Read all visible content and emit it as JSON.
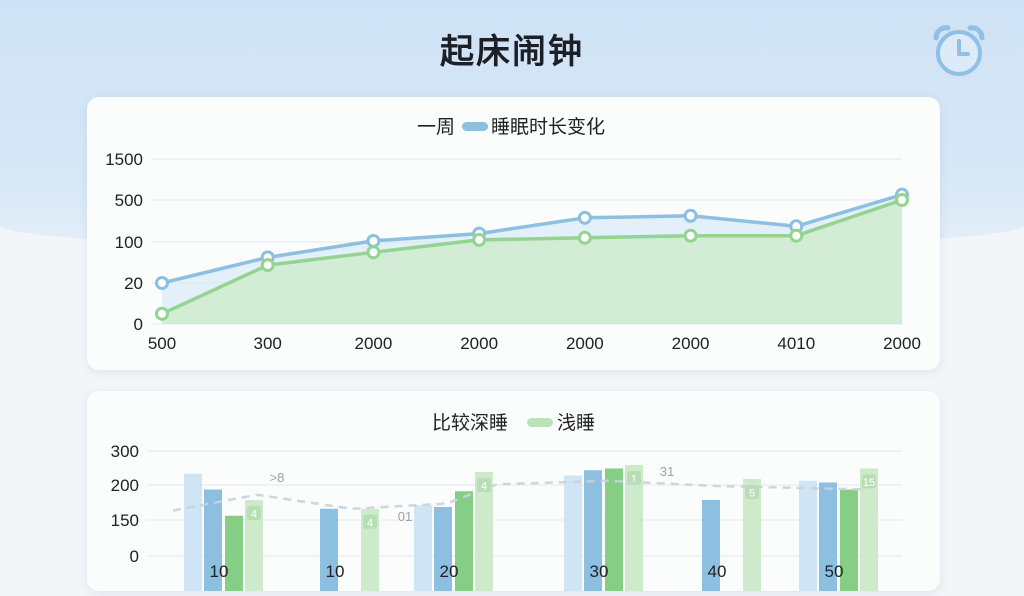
{
  "app": {
    "title": "起床闹钟",
    "icon": "alarm-clock-icon"
  },
  "colors": {
    "blue": "#8dbfe0",
    "green": "#93d491",
    "blue_light": "#cfe5f5",
    "green_light": "#cdebca"
  },
  "chart_data": [
    {
      "type": "line",
      "title": "",
      "legend": [
        "一周",
        "睡眠时长变化"
      ],
      "y_ticks": [
        "1500",
        "500",
        "100",
        "20",
        "0"
      ],
      "x_ticks": [
        "500",
        "300",
        "2000",
        "2000",
        "2000",
        "2000",
        "4010",
        "2000"
      ],
      "series": [
        {
          "name": "一周",
          "values": [
            20,
            70,
            110,
            180,
            330,
            350,
            250,
            630
          ]
        },
        {
          "name": "睡眠时长变化",
          "values": [
            5,
            55,
            80,
            120,
            140,
            160,
            160,
            500
          ]
        }
      ],
      "ylim": [
        0,
        1500
      ],
      "grid": true,
      "area": true
    },
    {
      "type": "bar",
      "title": "",
      "legend": [
        "比较深睡",
        "浅睡"
      ],
      "y_ticks": [
        "300",
        "200",
        "150",
        "0"
      ],
      "x_ticks": [
        "10",
        "10",
        "20",
        "30",
        "40",
        "50"
      ],
      "series": [
        {
          "name": "light-blue",
          "values": [
            235,
            null,
            145,
            230,
            null,
            215
          ]
        },
        {
          "name": "blue",
          "values": [
            190,
            135,
            140,
            245,
            160,
            210
          ]
        },
        {
          "name": "green",
          "values": [
            115,
            null,
            185,
            250,
            null,
            190
          ]
        },
        {
          "name": "比较深睡",
          "values": [
            160,
            135,
            240,
            260,
            220,
            250
          ]
        }
      ],
      "data_labels": [
        "4",
        "4",
        "4",
        "1",
        "5",
        "15"
      ],
      "trend_labels": [
        ">8",
        "01",
        "31"
      ],
      "ylim": [
        0,
        300
      ],
      "grid": true
    }
  ]
}
